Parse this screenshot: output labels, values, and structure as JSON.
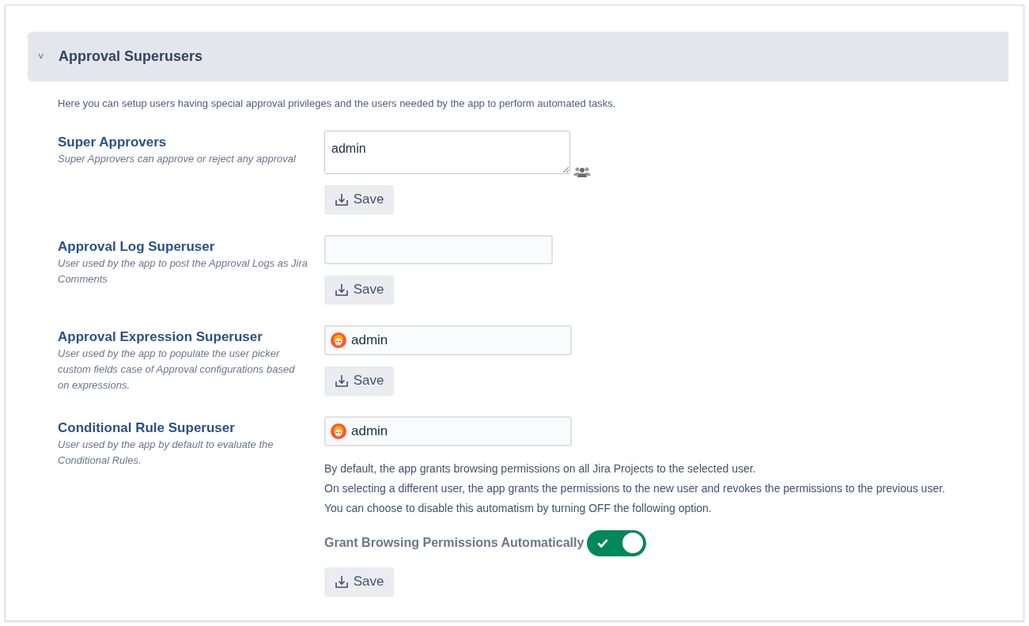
{
  "section": {
    "title": "Approval Superusers",
    "expanded": true,
    "caret": "˅",
    "description": "Here you can setup users having special approval privileges and the users needed by the app to perform automated tasks."
  },
  "settings": [
    {
      "label": "Super Approvers",
      "help": "Super Approvers can approve or reject any approval",
      "field": {
        "kind": "textarea",
        "value": "admin"
      },
      "save": "Save"
    },
    {
      "label": "Approval Log Superuser",
      "help": "User used by the app to post the Approval Logs as Jira Comments",
      "field": {
        "kind": "text"
      },
      "save": "Save"
    },
    {
      "label": "Approval Expression Superuser",
      "help": "User used by the app to populate the user picker custom fields case of Approval configurations based on expressions.",
      "field": {
        "kind": "user",
        "value": "admin"
      },
      "save": "Save"
    },
    {
      "label": "Conditional Rule Superuser",
      "help": "User used by the app by default to evaluate the Conditional Rules.",
      "field": {
        "kind": "user",
        "value": "admin"
      },
      "notes": [
        "By default, the app grants browsing permissions on all Jira Projects to the selected user.",
        "On selecting a different user, the app grants the permissions to the new user and revokes the permissions to the previous user.",
        "You can choose to disable this automatism by turning OFF the following option."
      ],
      "toggle": {
        "label": "Grant Browsing Permissions Automatically",
        "on": true
      },
      "save": "Save"
    }
  ]
}
